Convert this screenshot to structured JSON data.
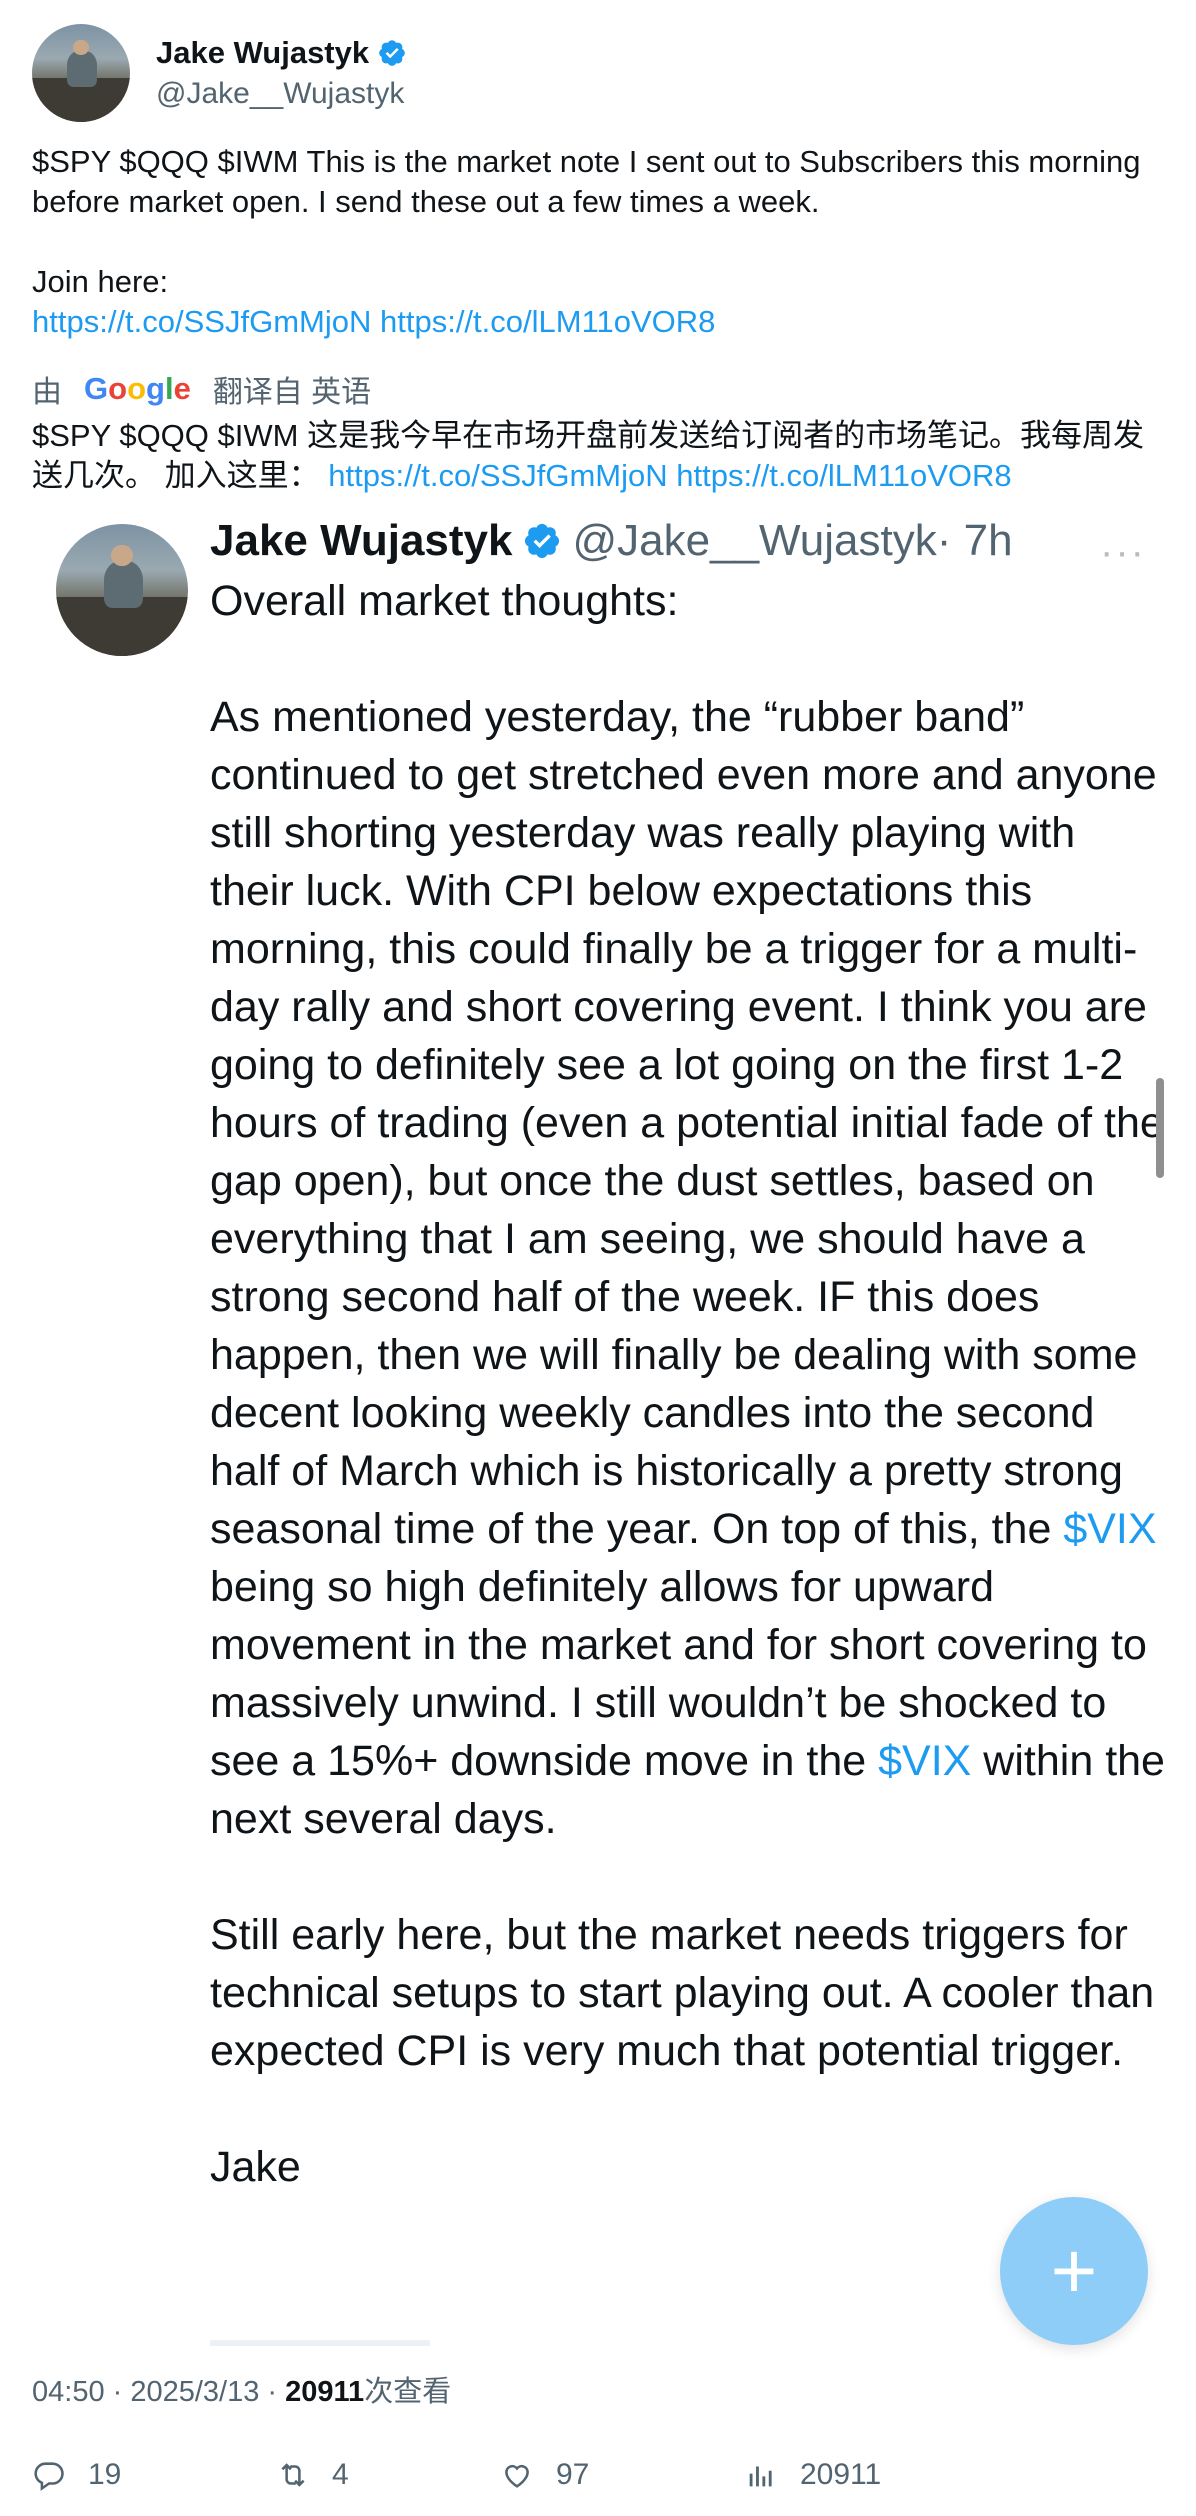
{
  "author": {
    "name": "Jake Wujastyk",
    "handle": "@Jake__Wujastyk"
  },
  "tweet": {
    "text": "$SPY $QQQ $IWM This is the market note I sent out to Subscribers this morning before market open. I send these out a few times a week.\n\nJoin here:",
    "link1": "https://t.co/SSJfGmMjoN",
    "link2": "https://t.co/lLM11oVOR8"
  },
  "translation": {
    "prefix": "由",
    "provider": "Google",
    "label": "翻译自 英语",
    "text": "$SPY $QQQ $IWM 这是我今早在市场开盘前发送给订阅者的市场笔记。我每周发送几次。 加入这里：",
    "link1": "https://t.co/SSJfGmMjoN",
    "link2": "https://t.co/lLM11oVOR8"
  },
  "embedded": {
    "name": "Jake Wujastyk",
    "handle": "@Jake__Wujastyk",
    "time": "· 7h",
    "dots": "···",
    "line_title": "Overall market thoughts:",
    "para1_a": "As mentioned yesterday, the “rubber band” continued to get stretched even more and anyone still shorting yesterday was really playing with their luck. With CPI below expectations this morning, this could finally be a trigger for a multi-day rally and short covering event. I think you are going to definitely see a lot going on the first 1-2 hours of trading (even a potential initial fade of the gap open), but once the dust settles, based on everything that I am seeing, we should have a strong second half of the week. IF this does happen, then we will finally be dealing with some decent looking weekly candles into the second half of March which is historically a pretty strong seasonal time of the year. On top of this, the ",
    "cashtag1": "$VIX",
    "para1_b": " being so high definitely allows for upward movement in the market and for short covering to massively unwind. I still wouldn’t be shocked to see a 15%+ downside move in the ",
    "cashtag2": "$VIX",
    "para1_c": " within the next several days.",
    "para2": "Still early here, but the market needs triggers for technical setups to start playing out. A cooler than expected CPI is very much that potential trigger.",
    "signature": "Jake"
  },
  "fab": {
    "label": "+"
  },
  "meta": {
    "time": "04:50 · 2025/3/13 · ",
    "views": "20911",
    "views_suffix": "次查看"
  },
  "actions": {
    "replies": "19",
    "retweets": "4",
    "likes": "97",
    "views": "20911"
  },
  "colors": {
    "link": "#1d9bf0",
    "muted": "#536471",
    "fab": "#8ecdf7"
  }
}
